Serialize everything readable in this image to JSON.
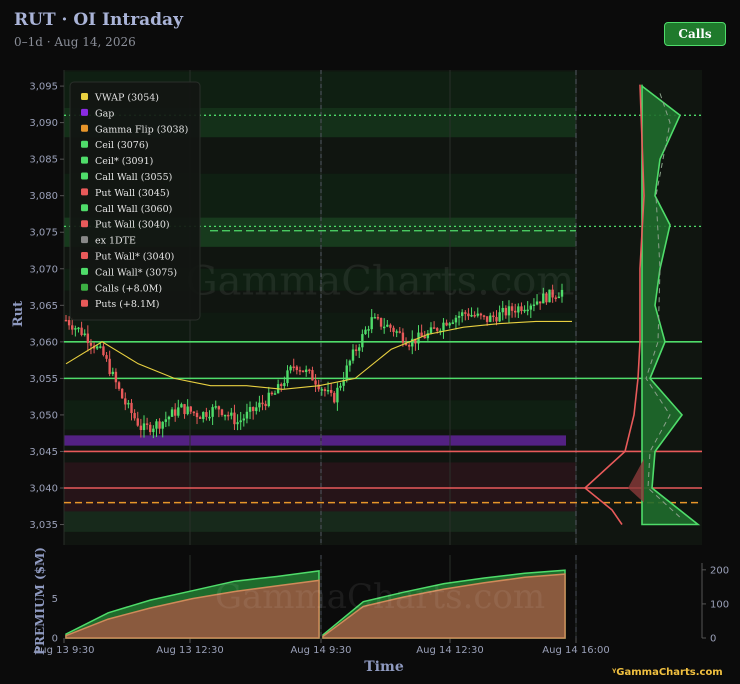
{
  "header": {
    "title": "RUT · OI Intraday",
    "subtitle": "0–1d · Aug 14, 2026",
    "calls_button": "Calls"
  },
  "brand": "GammaCharts.com",
  "colors": {
    "background": "#0b0b0b",
    "call_green": "#4fdc6a",
    "put_red": "#e85a5a",
    "vwap": "#e8d040",
    "gap": "#8a2be2",
    "gamma_flip": "#e8962a"
  },
  "chart_data": [
    {
      "type": "candlestick",
      "ylabel": "Rut",
      "xlabel": "Time",
      "ylim": [
        3032,
        3096
      ],
      "yticks": [
        "3,095",
        "3,090",
        "3,085",
        "3,080",
        "3,075",
        "3,070",
        "3,065",
        "3,060",
        "3,055",
        "3,050",
        "3,045",
        "3,040",
        "3,035"
      ],
      "ytick_values": [
        3095,
        3090,
        3085,
        3080,
        3075,
        3070,
        3065,
        3060,
        3055,
        3050,
        3045,
        3040,
        3035
      ],
      "xticks": [
        "Aug 13 9:30",
        "Aug 13 12:30",
        "Aug 14 9:30",
        "Aug 14 12:30",
        "Aug 14 16:00"
      ],
      "legend": [
        {
          "label": "VWAP (3054)",
          "color": "#e8d040"
        },
        {
          "label": "Gap",
          "color": "#8a2be2"
        },
        {
          "label": "Gamma Flip (3038)",
          "color": "#e8962a"
        },
        {
          "label": "Ceil (3076)",
          "color": "#4fdc6a"
        },
        {
          "label": "Ceil* (3091)",
          "color": "#4fdc6a"
        },
        {
          "label": "Call Wall (3055)",
          "color": "#4fdc6a"
        },
        {
          "label": "Put Wall (3045)",
          "color": "#e85a5a"
        },
        {
          "label": "Call Wall (3060)",
          "color": "#4fdc6a"
        },
        {
          "label": "Put Wall (3040)",
          "color": "#e85a5a"
        },
        {
          "label": "ex 1DTE",
          "color": "#888888"
        },
        {
          "label": "Put Wall* (3040)",
          "color": "#e85a5a"
        },
        {
          "label": "Call Wall* (3075)",
          "color": "#4fdc6a"
        },
        {
          "label": "Calls (+8.0M)",
          "color": "#3cb043"
        },
        {
          "label": "Puts (+8.1M)",
          "color": "#e85a5a"
        }
      ],
      "levels": {
        "ceil_3076": 3075.8,
        "ceil_star_3091": 3091,
        "call_wall_3060": 3060,
        "call_wall_3055": 3055,
        "put_wall_3045": 3045,
        "put_wall_3040": 3040,
        "gamma_flip": 3038,
        "gap_range": [
          3045.8,
          3047.2
        ]
      },
      "price_path": [
        3063,
        3061,
        3058,
        3052,
        3048,
        3049,
        3051,
        3050,
        3051,
        3049,
        3051,
        3053,
        3057,
        3055,
        3052,
        3058,
        3063,
        3062,
        3060,
        3061,
        3063,
        3064,
        3063,
        3064,
        3065,
        3066,
        3067
      ],
      "vwap_path": [
        3057,
        3060,
        3057,
        3055,
        3054,
        3054,
        3053.5,
        3054,
        3055,
        3059,
        3061,
        3062,
        3062.5,
        3062.8,
        3062.8
      ]
    },
    {
      "type": "area",
      "ylabel": "PREMIUM ($M)",
      "ylim": [
        0,
        9
      ],
      "yticks_left": [
        "0",
        "5"
      ],
      "yticks_right": [
        "200",
        "100",
        "0"
      ],
      "series": [
        {
          "name": "Calls (+8.0M)",
          "values": [
            0.5,
            3.2,
            4.8,
            6.0,
            7.2,
            7.8,
            8.5,
            0.4,
            4.6,
            5.8,
            6.9,
            7.6,
            8.2,
            8.6
          ]
        },
        {
          "name": "Puts (+8.1M)",
          "values": [
            0.3,
            2.4,
            3.8,
            5.0,
            5.9,
            6.6,
            7.3,
            0.2,
            4.0,
            5.2,
            6.2,
            7.0,
            7.7,
            8.1
          ]
        }
      ]
    }
  ]
}
